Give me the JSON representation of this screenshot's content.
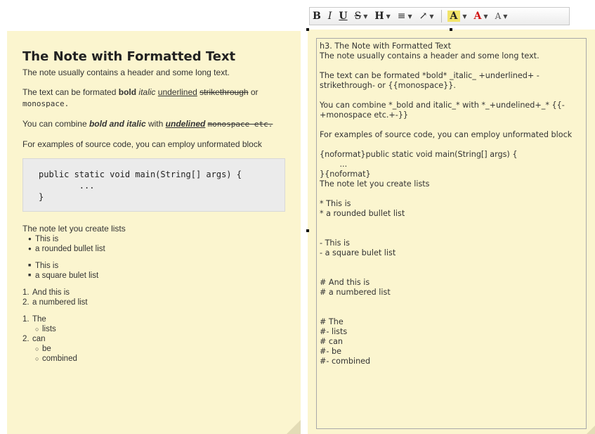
{
  "toolbar": {
    "bold": "B",
    "italic": "I",
    "underline": "U",
    "strike": "S",
    "heading": "H",
    "list": "≡",
    "link": "↗",
    "highlight": "A",
    "font_color": "A",
    "font_size": "A",
    "caret": "▼"
  },
  "note": {
    "title": "The Note with Formatted Text",
    "intro": "The note usually contains a header and some long text.",
    "formats_prefix": "The text can be formated ",
    "bold": "bold",
    "italic": "italic",
    "underlined": "underlined",
    "strikethrough": "strikethrough",
    "or": " or",
    "monospace": "monospace.",
    "combine_prefix": "You can combine ",
    "bold_italic": "bold and italic",
    "with": " with ",
    "undelined": "undelined",
    "mono_strike": "monospace etc.",
    "code_intro": "For examples of source code, you can employ unformated block",
    "code": "public static void main(String[] args) {\n        ...\n}",
    "lists_intro": "The note let you create lists",
    "round_list": [
      "This is",
      "a rounded bullet list"
    ],
    "square_list": [
      "This is",
      "a square bulet list"
    ],
    "numbered_list": [
      "And this is",
      "a numbered list"
    ],
    "combined_1": "The",
    "combined_1_sub": [
      "lists"
    ],
    "combined_2": "can",
    "combined_2_sub": [
      "be",
      "combined"
    ]
  },
  "editor": {
    "source": "h3. The Note with Formatted Text\nThe note usually contains a header and some long text.\n\nThe text can be formated *bold* _italic_ +underlined+ -strikethrough- or {{monospace}}.\n\nYou can combine *_bold and italic_* with *_+undelined+_* {{-+monospace etc.+-}}\n\nFor examples of source code, you can employ unformated block\n\n{noformat}public static void main(String[] args) {\n        ...\n}{noformat}\nThe note let you create lists\n\n* This is\n* a rounded bullet list\n\n\n- This is\n- a square bulet list\n\n\n# And this is\n# a numbered list\n\n\n# The\n#- lists\n# can\n#- be\n#- combined"
  }
}
